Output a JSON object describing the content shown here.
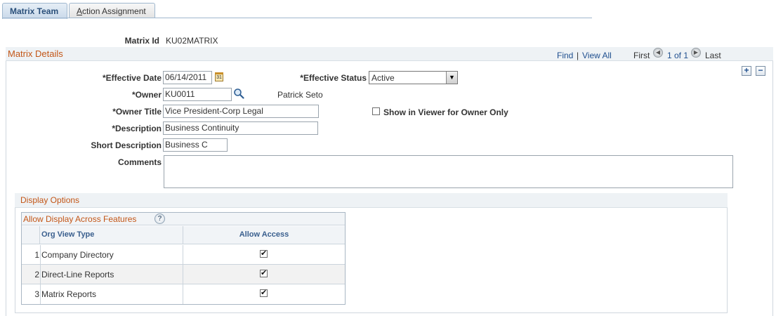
{
  "tabs": [
    {
      "label": "Matrix Team",
      "active": true
    },
    {
      "label_accel": "A",
      "label_rest": "ction Assignment",
      "active": false
    }
  ],
  "matrix_id": {
    "label": "Matrix Id",
    "value": "KU02MATRIX"
  },
  "details": {
    "title": "Matrix Details",
    "nav": {
      "find": "Find",
      "separator": "|",
      "view_all": "View All",
      "first": "First",
      "position": "1 of 1",
      "last": "Last",
      "prev_glyph": "◀",
      "next_glyph": "▶"
    },
    "add_row": "+",
    "delete_row": "−",
    "effective_date": {
      "label": "*Effective Date",
      "value": "06/14/2011",
      "calendar_glyph": "31"
    },
    "effective_status": {
      "label": "*Effective Status",
      "value": "Active"
    },
    "owner": {
      "label": "*Owner",
      "value": "KU0011",
      "name": "Patrick Seto"
    },
    "owner_title": {
      "label": "*Owner Title",
      "value": "Vice President-Corp Legal"
    },
    "show_in_viewer": {
      "label": "Show in Viewer for Owner Only",
      "checked": false
    },
    "description": {
      "label": "*Description",
      "value": "Business Continuity"
    },
    "short_description": {
      "label": "Short Description",
      "value": "Business C"
    },
    "comments": {
      "label": "Comments",
      "value": ""
    }
  },
  "display_options": {
    "title": "Display Options",
    "grid": {
      "title": "Allow Display Across Features",
      "help_glyph": "?",
      "columns": [
        "Org View Type",
        "Allow Access"
      ],
      "rows": [
        {
          "num": "1",
          "type": "Company Directory",
          "allow": true
        },
        {
          "num": "2",
          "type": "Direct-Line Reports",
          "allow": true
        },
        {
          "num": "3",
          "type": "Matrix Reports",
          "allow": true
        }
      ]
    }
  },
  "colors": {
    "section_title": "#c35617",
    "link": "#1f4f8f",
    "column_header": "#3a5f8e"
  }
}
